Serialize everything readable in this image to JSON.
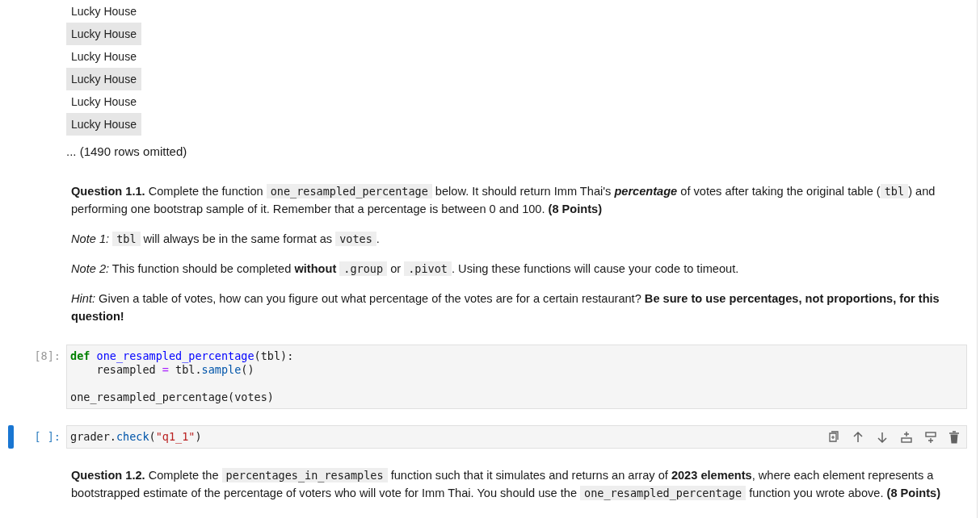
{
  "table_rows": [
    {
      "text": "Lucky House",
      "shaded": false
    },
    {
      "text": "Lucky House",
      "shaded": true
    },
    {
      "text": "Lucky House",
      "shaded": false
    },
    {
      "text": "Lucky House",
      "shaded": true
    },
    {
      "text": "Lucky House",
      "shaded": false
    },
    {
      "text": "Lucky House",
      "shaded": true
    }
  ],
  "rows_omitted": "... (1490 rows omitted)",
  "markdown_1": [
    [
      {
        "kind": "text",
        "text": "**Question 1.1.** Complete the function "
      },
      {
        "kind": "code",
        "text": "one_resampled_percentage"
      },
      {
        "kind": "text",
        "text": " below. It should return Imm Thai's "
      },
      {
        "kind": "emph",
        "text": "percentage"
      },
      {
        "kind": "text",
        "text": " of votes after taking the original table ("
      },
      {
        "kind": "code",
        "text": "tbl"
      },
      {
        "kind": "text",
        "text": ") and performing one bootstrap sample of it. Remember that a percentage is between 0 and 100. **(8 Points)**"
      }
    ],
    [
      {
        "kind": "text",
        "text": "*Note 1:* "
      },
      {
        "kind": "code",
        "text": "tbl"
      },
      {
        "kind": "text",
        "text": " will always be in the same format as "
      },
      {
        "kind": "code",
        "text": "votes"
      },
      {
        "kind": "text",
        "text": "."
      }
    ],
    [
      {
        "kind": "text",
        "text": "*Note 2:* This function should be completed **without** "
      },
      {
        "kind": "code",
        "text": ".group"
      },
      {
        "kind": "text",
        "text": " or "
      },
      {
        "kind": "code",
        "text": ".pivot"
      },
      {
        "kind": "text",
        "text": ". Using these functions will cause your code to timeout."
      }
    ],
    [
      {
        "kind": "text",
        "text": "*Hint:* Given a table of votes, how can you figure out what percentage of the votes are for a certain restaurant? **Be sure to use percentages, not proportions, for this question!**"
      }
    ]
  ],
  "code_cells": [
    {
      "prompt": "[8]:",
      "selected": false,
      "lines": [
        {
          "blank_before": false,
          "tokens": [
            {
              "kind": "keyword",
              "text": "def "
            },
            {
              "kind": "defname",
              "text": "one_resampled_percentage"
            },
            {
              "kind": "plain",
              "text": "(tbl):"
            }
          ]
        },
        {
          "blank_before": false,
          "tokens": [
            {
              "kind": "plain",
              "text": "    resampled "
            },
            {
              "kind": "operator",
              "text": "="
            },
            {
              "kind": "plain",
              "text": " tbl."
            },
            {
              "kind": "method",
              "text": "sample"
            },
            {
              "kind": "plain",
              "text": "()"
            }
          ]
        },
        {
          "blank_before": true,
          "tokens": [
            {
              "kind": "plain",
              "text": "one_resampled_percentage(votes)"
            }
          ]
        }
      ]
    },
    {
      "prompt": "[ ]:",
      "selected": true,
      "lines": [
        {
          "blank_before": false,
          "tokens": [
            {
              "kind": "plain",
              "text": "grader."
            },
            {
              "kind": "method",
              "text": "check"
            },
            {
              "kind": "plain",
              "text": "("
            },
            {
              "kind": "string",
              "text": "\"q1_1\""
            },
            {
              "kind": "plain",
              "text": ")"
            }
          ]
        }
      ]
    }
  ],
  "markdown_2": [
    [
      {
        "kind": "text",
        "text": "**Question 1.2.** Complete the "
      },
      {
        "kind": "code",
        "text": "percentages_in_resamples"
      },
      {
        "kind": "text",
        "text": " function such that it simulates and returns an array of **2023 elements**, where each element represents a bootstrapped estimate of the percentage of voters who will vote for Imm Thai. You should use the "
      },
      {
        "kind": "code",
        "text": "one_resampled_percentage"
      },
      {
        "kind": "text",
        "text": " function you wrote above. **(8 Points)**"
      }
    ]
  ]
}
